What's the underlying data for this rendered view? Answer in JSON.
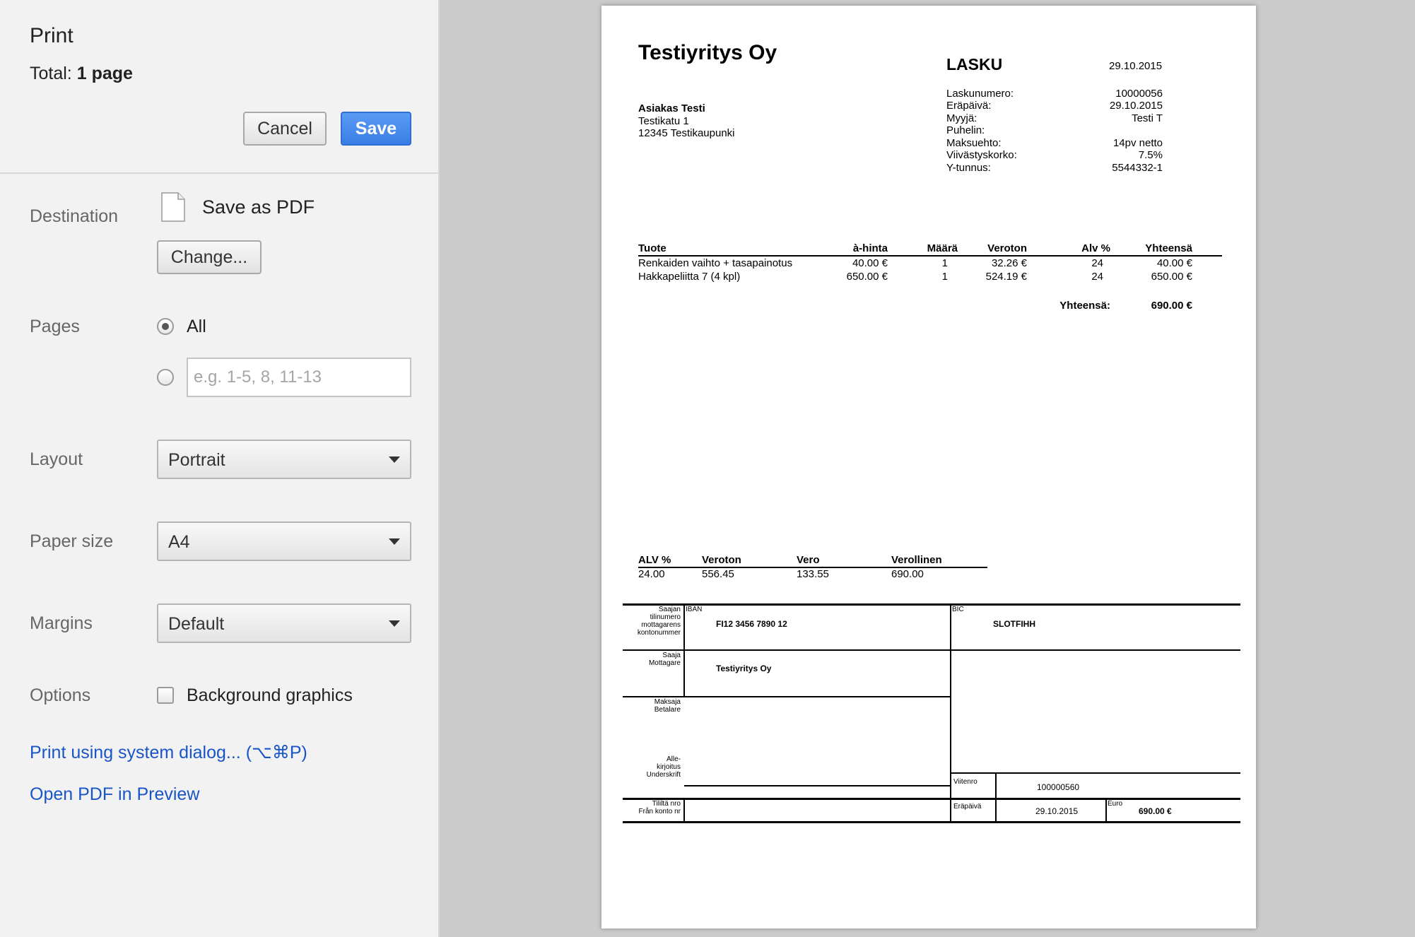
{
  "panel": {
    "title": "Print",
    "total_label": "Total:",
    "total_value": "1 page",
    "cancel_label": "Cancel",
    "save_label": "Save",
    "destination_label": "Destination",
    "destination_value": "Save as PDF",
    "change_label": "Change...",
    "pages_label": "Pages",
    "pages_all_label": "All",
    "pages_placeholder": "e.g. 1-5, 8, 11-13",
    "layout_label": "Layout",
    "layout_value": "Portrait",
    "paper_size_label": "Paper size",
    "paper_size_value": "A4",
    "margins_label": "Margins",
    "margins_value": "Default",
    "options_label": "Options",
    "background_graphics_label": "Background graphics",
    "background_graphics_checked": false,
    "system_dialog_link": "Print using system dialog... (⌥⌘P)",
    "open_pdf_link": "Open PDF in Preview"
  },
  "invoice": {
    "company": "Testiyritys Oy",
    "doc_title": "LASKU",
    "doc_date": "29.10.2015",
    "customer": {
      "name": "Asiakas Testi",
      "street": "Testikatu 1",
      "city": "12345 Testikaupunki"
    },
    "info": [
      {
        "label": "Laskunumero:",
        "value": "10000056"
      },
      {
        "label": "Eräpäivä:",
        "value": "29.10.2015"
      },
      {
        "label": "Myyjä:",
        "value": "Testi T"
      },
      {
        "label": "Puhelin:",
        "value": ""
      },
      {
        "label": "Maksuehto:",
        "value": "14pv netto"
      },
      {
        "label": "Viivästyskorko:",
        "value": "7.5%"
      },
      {
        "label": "Y-tunnus:",
        "value": "5544332-1"
      }
    ],
    "columns": [
      "Tuote",
      "à-hinta",
      "Määrä",
      "Veroton",
      "Alv %",
      "Yhteensä"
    ],
    "rows": [
      [
        "Renkaiden vaihto + tasapainotus",
        "40.00 €",
        "1",
        "32.26 €",
        "24",
        "40.00 €"
      ],
      [
        "Hakkapeliitta 7 (4 kpl)",
        "650.00 €",
        "1",
        "524.19 €",
        "24",
        "650.00 €"
      ]
    ],
    "total_label": "Yhteensä:",
    "total_value": "690.00 €",
    "vat_columns": [
      "ALV %",
      "Veroton",
      "Vero",
      "Verollinen"
    ],
    "vat_row": [
      "24.00",
      "556.45",
      "133.55",
      "690.00"
    ],
    "slip": {
      "saajan_label_1": "Saajan",
      "saajan_label_2": "tilinumero",
      "saajan_label_3": "mottagarens",
      "saajan_label_4": "kontonummer",
      "iban_label": "IBAN",
      "iban_value": "FI12 3456 7890 12",
      "bic_label": "BIC",
      "bic_value": "SLOTFIHH",
      "saaja_label_1": "Saaja",
      "saaja_label_2": "Mottagare",
      "saaja_value": "Testiyritys Oy",
      "maksaja_label_1": "Maksaja",
      "maksaja_label_2": "Betalare",
      "allekirjoitus_label_1": "Alle-",
      "allekirjoitus_label_2": "kirjoitus",
      "allekirjoitus_label_3": "Underskrift",
      "viitenro_label": "Viitenro",
      "viitenro_value": "100000560",
      "tililta_label_1": "Tililtä nro",
      "tililta_label_2": "Från konto nr",
      "erapaiva_label": "Eräpäivä",
      "erapaiva_value": "29.10.2015",
      "euro_label": "Euro",
      "euro_value": "690.00 €"
    }
  }
}
